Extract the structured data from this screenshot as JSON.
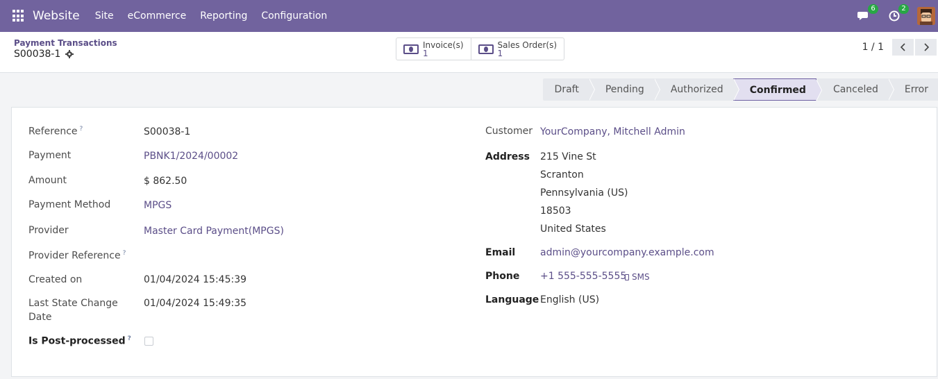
{
  "navbar": {
    "app_name": "Website",
    "menu": [
      "Site",
      "eCommerce",
      "Reporting",
      "Configuration"
    ],
    "messages_count": "6",
    "activities_count": "2"
  },
  "control_panel": {
    "breadcrumb": "Payment Transactions",
    "record_name": "S00038-1",
    "smart_buttons": [
      {
        "label": "Invoice(s)",
        "value": "1"
      },
      {
        "label": "Sales Order(s)",
        "value": "1"
      }
    ],
    "pager": "1 / 1"
  },
  "statusbar": {
    "stages": [
      "Draft",
      "Pending",
      "Authorized",
      "Confirmed",
      "Canceled",
      "Error"
    ],
    "active": "Confirmed"
  },
  "form": {
    "left": {
      "reference_label": "Reference",
      "reference": "S00038-1",
      "payment_label": "Payment",
      "payment": "PBNK1/2024/00002",
      "amount_label": "Amount",
      "amount": "$ 862.50",
      "payment_method_label": "Payment Method",
      "payment_method": "MPGS",
      "provider_label": "Provider",
      "provider": "Master Card Payment(MPGS)",
      "provider_reference_label": "Provider Reference",
      "created_on_label": "Created on",
      "created_on": "01/04/2024 15:45:39",
      "last_state_change_label_1": "Last State Change",
      "last_state_change_label_2": "Date",
      "last_state_change": "01/04/2024 15:49:35",
      "post_processed_label": "Is Post-processed",
      "help_mark": "?"
    },
    "right": {
      "customer_label": "Customer",
      "customer": "YourCompany, Mitchell Admin",
      "address_label": "Address",
      "address_lines": [
        "215 Vine St",
        "Scranton",
        "Pennsylvania (US)",
        "18503",
        "United States"
      ],
      "email_label": "Email",
      "email": "admin@yourcompany.example.com",
      "phone_label": "Phone",
      "phone": "+1 555-555-5555",
      "sms_label": "SMS",
      "language_label": "Language",
      "language": "English (US)"
    }
  },
  "colors": {
    "navbar": "#71639e",
    "link": "#5b4e88",
    "badge": "#28a745"
  }
}
